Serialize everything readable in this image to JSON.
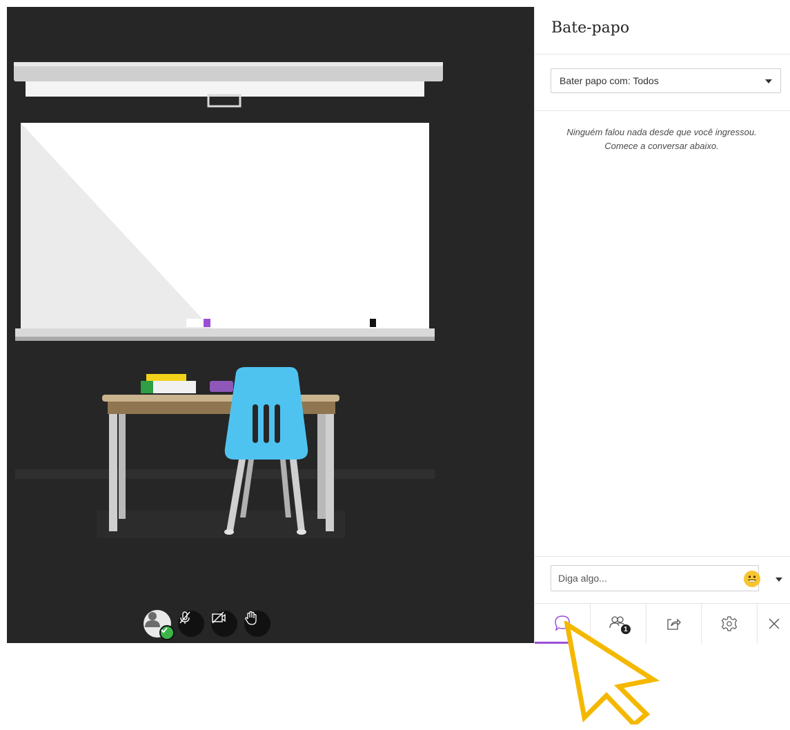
{
  "chat_panel": {
    "title": "Bate-papo",
    "chat_with": "Bater papo com: Todos",
    "empty_line1": "Ninguém falou nada desde que você ingressou.",
    "empty_line2": "Comece a conversar abaixo.",
    "compose_placeholder": "Diga algo..."
  },
  "tabs": [
    {
      "icon": "chat-bubble-icon",
      "active": true
    },
    {
      "icon": "attendees-icon",
      "badge": "1"
    },
    {
      "icon": "share-content-icon"
    },
    {
      "icon": "settings-gear-icon"
    },
    {
      "icon": "close-icon"
    }
  ],
  "session_controls": [
    "avatar-status",
    "microphone-muted-icon",
    "camera-off-icon",
    "raise-hand-icon"
  ],
  "colors": {
    "stage_bg": "#262626",
    "active_tab": "#9b4fd6",
    "cursor_outline": "#f5b800",
    "status_green": "#3bb54a",
    "chair_blue": "#4fc3f0"
  }
}
